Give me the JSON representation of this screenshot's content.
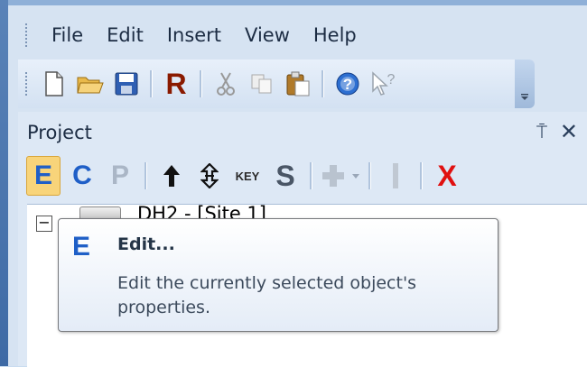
{
  "menu": {
    "items": [
      {
        "label": "File"
      },
      {
        "label": "Edit"
      },
      {
        "label": "Insert"
      },
      {
        "label": "View"
      },
      {
        "label": "Help"
      }
    ]
  },
  "toolbar": {
    "buttons": [
      "new-document-icon",
      "open-folder-icon",
      "save-icon",
      "R",
      "cut-icon",
      "copy-icon",
      "paste-icon",
      "help-icon",
      "context-help-icon"
    ],
    "r_label": "R",
    "help_label": "?"
  },
  "panel": {
    "title": "Project",
    "pin_glyph": "⍑",
    "close_glyph": "✕",
    "tools": {
      "edit": "E",
      "c": "C",
      "p": "P",
      "key": "KEY",
      "s": "S",
      "delete": "X"
    },
    "tree": {
      "expander": "−",
      "node_label": "DH2 - [Site 1]"
    }
  },
  "tooltip": {
    "icon": "E",
    "title": "Edit...",
    "description": "Edit the currently selected object's properties."
  },
  "colors": {
    "accent_blue": "#1f5fc7",
    "dark_red": "#8a1a00",
    "delete_red": "#e01010",
    "edit_highlight": "#f8d47a"
  }
}
